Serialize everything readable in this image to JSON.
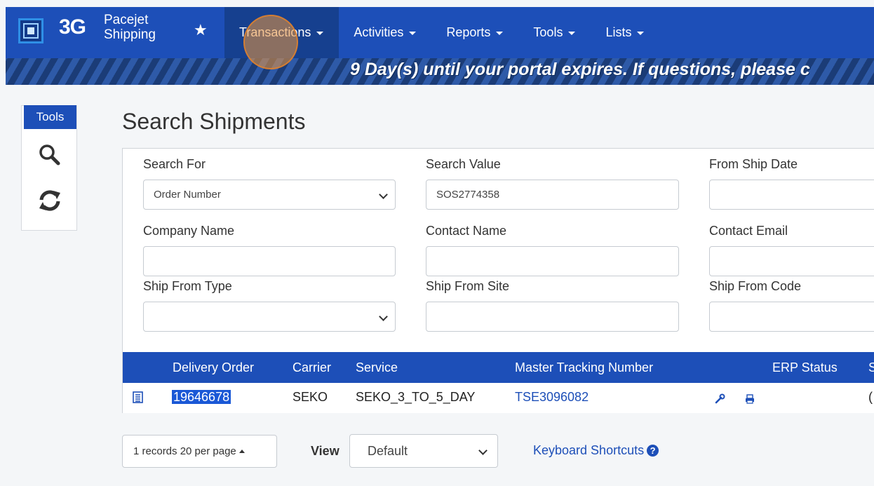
{
  "header": {
    "brand_short": "3G",
    "brand_line1": "Pacejet",
    "brand_line2": "Shipping",
    "favorite_icon": "star-icon",
    "nav": [
      {
        "label": "Transactions"
      },
      {
        "label": "Activities"
      },
      {
        "label": "Reports"
      },
      {
        "label": "Tools"
      },
      {
        "label": "Lists"
      }
    ]
  },
  "banner": {
    "text": "9 Day(s) until your portal expires. If questions, please c"
  },
  "tools": {
    "title": "Tools",
    "icons": [
      "search-icon",
      "refresh-icon"
    ]
  },
  "page": {
    "title": "Search Shipments"
  },
  "form": {
    "search_for_label": "Search For",
    "search_for_value": "Order Number",
    "search_value_label": "Search Value",
    "search_value": "SOS2774358",
    "from_ship_date_label": "From Ship Date",
    "from_ship_date_value": "",
    "company_name_label": "Company Name",
    "company_name_value": "",
    "contact_name_label": "Contact Name",
    "contact_name_value": "",
    "contact_email_label": "Contact Email",
    "contact_email_value": "",
    "ship_from_type_label": "Ship From Type",
    "ship_from_type_value": "",
    "ship_from_site_label": "Ship From Site",
    "ship_from_site_value": "",
    "ship_from_code_label": "Ship From Code",
    "ship_from_code_value": ""
  },
  "table": {
    "columns": [
      "Delivery Order",
      "Carrier",
      "Service",
      "Master Tracking Number",
      "ERP Status",
      "S"
    ],
    "rows": [
      {
        "delivery_order": "19646678",
        "carrier": "SEKO",
        "service": "SEKO_3_TO_5_DAY",
        "master_tracking": "TSE3096082",
        "erp_status": "",
        "last_col": "("
      }
    ]
  },
  "footer": {
    "pager_label": "1 records 20 per page",
    "view_label": "View",
    "view_value": "Default",
    "keyboard_shortcuts": "Keyboard Shortcuts"
  },
  "colors": {
    "primary": "#1d4fb8",
    "nav_active": "#16408f",
    "banner_dark": "#1b3c77",
    "selection": "#1a58d6"
  }
}
